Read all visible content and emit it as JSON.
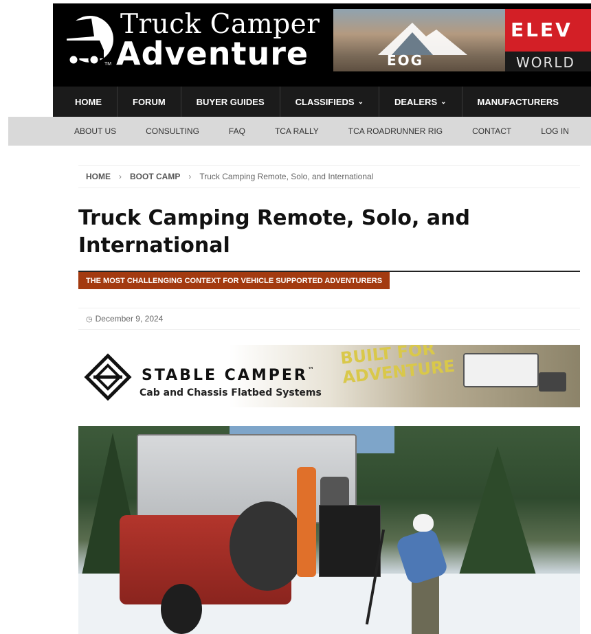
{
  "header": {
    "logo_line1": "Truck Camper",
    "logo_line2": "Adventure",
    "logo_tm": "TM",
    "ad": {
      "eog_text": "EOG",
      "elevate_text": "ELEV",
      "world_text": "WORLD"
    }
  },
  "main_nav": {
    "items": [
      {
        "label": "HOME",
        "has_dropdown": false
      },
      {
        "label": "FORUM",
        "has_dropdown": false
      },
      {
        "label": "BUYER GUIDES",
        "has_dropdown": false
      },
      {
        "label": "CLASSIFIEDS",
        "has_dropdown": true
      },
      {
        "label": "DEALERS",
        "has_dropdown": true
      },
      {
        "label": "MANUFACTURERS",
        "has_dropdown": false
      }
    ],
    "chevron": "⌄"
  },
  "sub_nav": {
    "items": [
      "ABOUT US",
      "CONSULTING",
      "FAQ",
      "TCA RALLY",
      "TCA ROADRUNNER RIG",
      "CONTACT",
      "LOG IN"
    ]
  },
  "breadcrumb": {
    "home": "HOME",
    "section": "BOOT CAMP",
    "current": "Truck Camping Remote, Solo, and International",
    "separator": "›"
  },
  "article": {
    "title": "Truck Camping Remote, Solo, and International",
    "subtitle": "THE MOST CHALLENGING CONTEXT FOR VEHICLE SUPPORTED ADVENTURERS",
    "date": "December 9, 2024",
    "date_icon": "clock-icon"
  },
  "ad_stable": {
    "brand": "STABLE CAMPER",
    "tm": "™",
    "tagline": "Cab and Chassis Flatbed Systems",
    "built_line1": "BUILT FOR",
    "built_line2": "ADVENTURE"
  },
  "colors": {
    "header_bg": "#000000",
    "nav_bg": "#1b1b1b",
    "subnav_bg": "#d9d9d9",
    "accent": "#a33a10"
  }
}
